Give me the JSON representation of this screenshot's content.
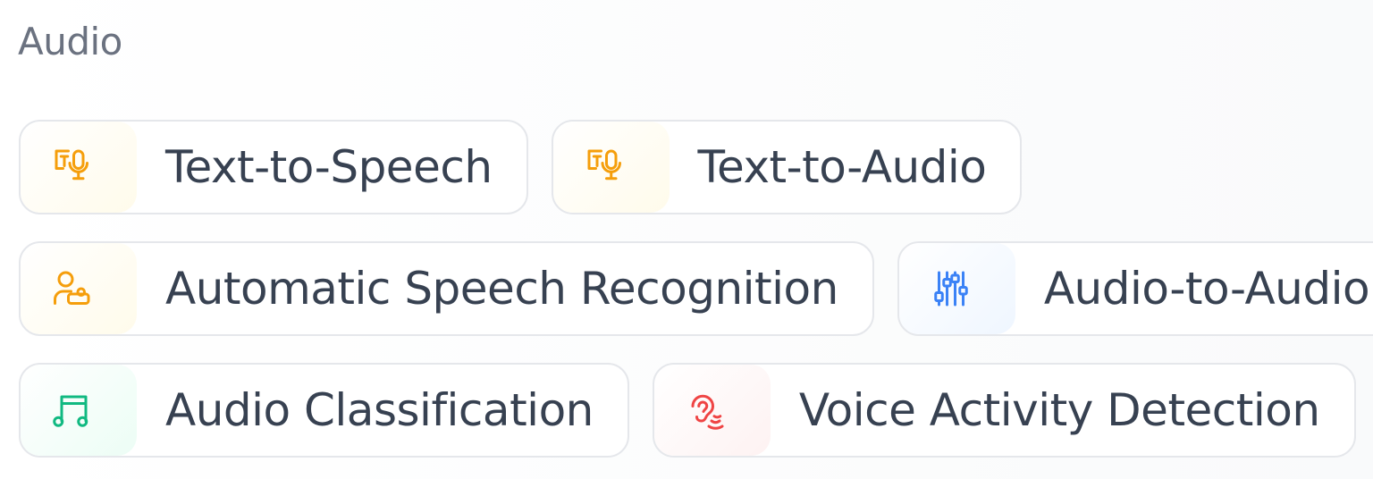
{
  "section": {
    "title": "Audio"
  },
  "tasks": [
    {
      "label": "Text-to-Speech",
      "icon": "text-microphone-icon",
      "accent": "#f59e0b"
    },
    {
      "label": "Text-to-Audio",
      "icon": "text-microphone-icon",
      "accent": "#f59e0b"
    },
    {
      "label": "Automatic Speech Recognition",
      "icon": "speaker-person-icon",
      "accent": "#f59e0b"
    },
    {
      "label": "Audio-to-Audio",
      "icon": "equalizer-sliders-icon",
      "accent": "#3b82f6"
    },
    {
      "label": "Audio Classification",
      "icon": "music-note-icon",
      "accent": "#10b981"
    },
    {
      "label": "Voice Activity Detection",
      "icon": "ear-sound-icon",
      "accent": "#ef4444"
    }
  ]
}
